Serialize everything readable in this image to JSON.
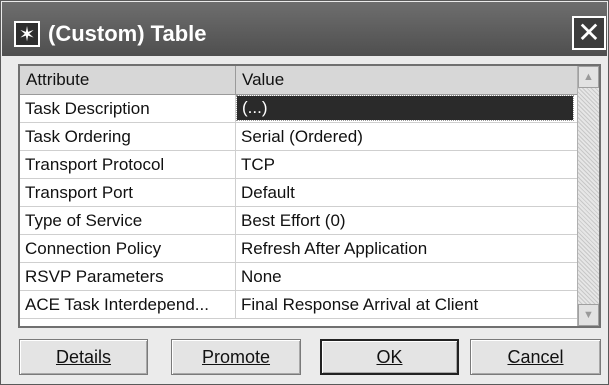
{
  "window": {
    "title": "(Custom) Table",
    "app_icon": "asterisk-icon",
    "close_glyph": "✕"
  },
  "table": {
    "columns": [
      "Attribute",
      "Value"
    ],
    "rows": [
      {
        "attribute": "Task Description",
        "value": "(...)",
        "selected": true
      },
      {
        "attribute": "Task Ordering",
        "value": "Serial (Ordered)"
      },
      {
        "attribute": "Transport Protocol",
        "value": "TCP"
      },
      {
        "attribute": "Transport Port",
        "value": "Default"
      },
      {
        "attribute": "Type of Service",
        "value": "Best Effort (0)"
      },
      {
        "attribute": "Connection Policy",
        "value": "Refresh After Application"
      },
      {
        "attribute": "RSVP Parameters",
        "value": "None"
      },
      {
        "attribute": "ACE Task Interdepend...",
        "value": "Final Response Arrival at Client"
      }
    ],
    "scroll_up_glyph": "▲",
    "scroll_down_glyph": "▼"
  },
  "buttons": {
    "details": "Details",
    "promote": "Promote",
    "ok": "OK",
    "cancel": "Cancel"
  },
  "colors": {
    "title_bar": "#5a5a5a",
    "selection": "#2a2a2a",
    "header_bg": "#d7d7d7"
  }
}
